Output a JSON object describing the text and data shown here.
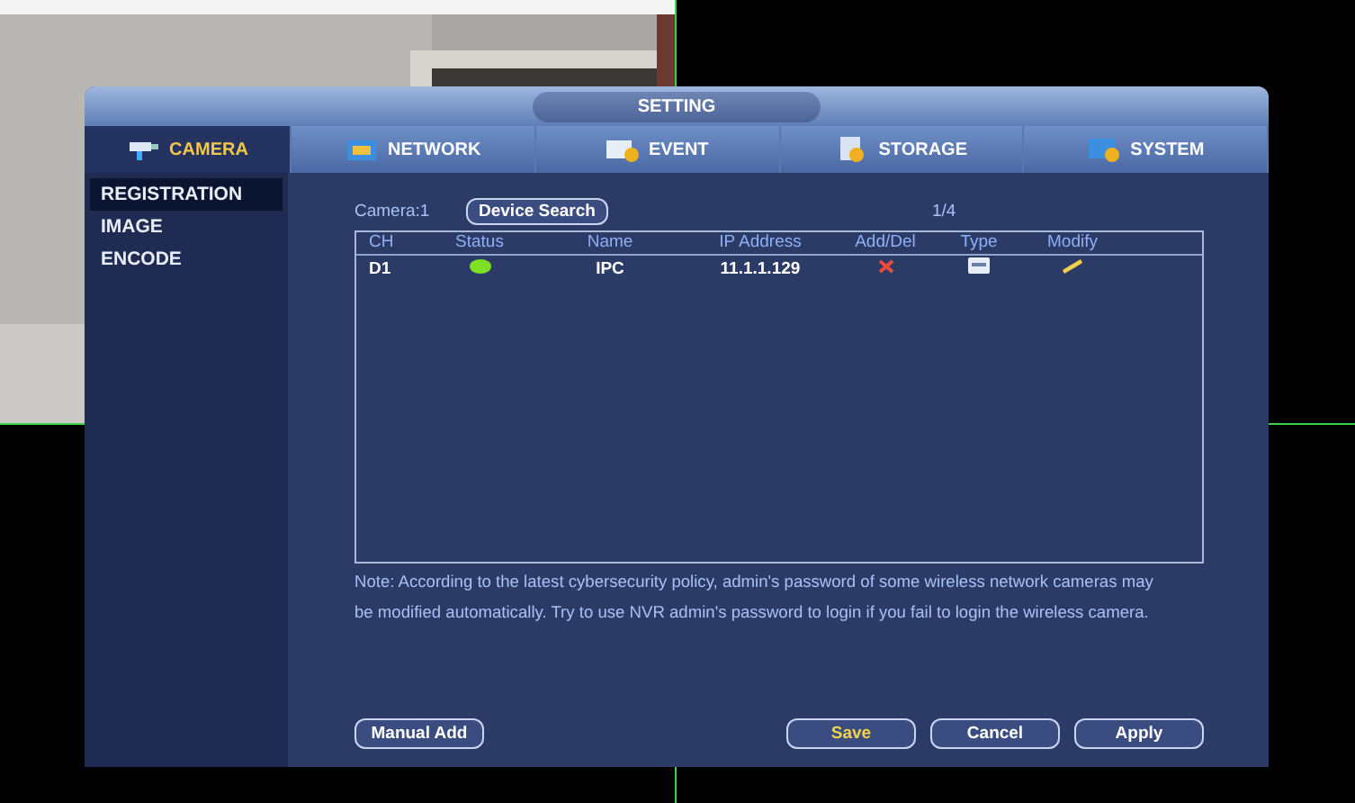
{
  "window": {
    "title": "SETTING"
  },
  "tabs": [
    {
      "label": "CAMERA",
      "selected": true
    },
    {
      "label": "NETWORK",
      "selected": false
    },
    {
      "label": "EVENT",
      "selected": false
    },
    {
      "label": "STORAGE",
      "selected": false
    },
    {
      "label": "SYSTEM",
      "selected": false
    }
  ],
  "sidebar": {
    "items": [
      {
        "label": "REGISTRATION",
        "selected": true
      },
      {
        "label": "IMAGE",
        "selected": false
      },
      {
        "label": "ENCODE",
        "selected": false
      }
    ]
  },
  "camera_label": "Camera:1",
  "device_search": "Device Search",
  "page": "1/4",
  "table": {
    "columns": [
      "CH",
      "Status",
      "Name",
      "IP Address",
      "Add/Del",
      "Type",
      "Modify"
    ],
    "rows": [
      {
        "ch": "D1",
        "online": true,
        "name": "IPC",
        "ip": "11.1.1.129"
      }
    ]
  },
  "note": "Note: According to the latest cybersecurity policy, admin's password of some wireless network cameras may be modified automatically. Try to use NVR admin's password to login if you fail to login the wireless camera.",
  "manual_add": "Manual Add",
  "buttons": [
    {
      "label": "Save",
      "hovered": true
    },
    {
      "label": "Cancel",
      "hovered": false
    },
    {
      "label": "Apply",
      "hovered": false
    }
  ]
}
